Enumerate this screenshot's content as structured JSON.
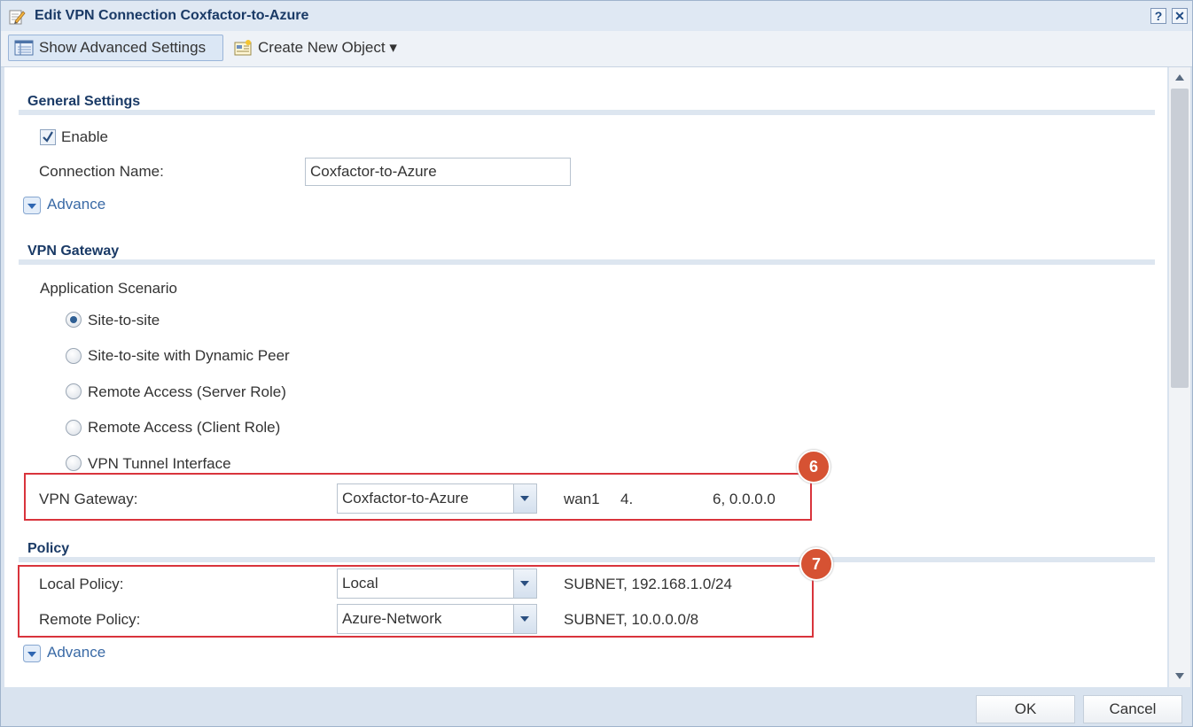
{
  "window": {
    "title": "Edit VPN Connection Coxfactor-to-Azure",
    "help_label": "?",
    "close_label": "✕"
  },
  "toolbar": {
    "advanced_label": "Show Advanced Settings",
    "create_label": "Create New Object ▾"
  },
  "general": {
    "title": "General Settings",
    "enable_label": "Enable",
    "enable_checked": true,
    "connection_name_label": "Connection Name:",
    "connection_name_value": "Coxfactor-to-Azure",
    "advance_label": "Advance"
  },
  "vpn_gateway_section": {
    "title": "VPN Gateway",
    "scenario_label": "Application Scenario",
    "options": [
      {
        "label": "Site-to-site",
        "selected": true
      },
      {
        "label": "Site-to-site with Dynamic Peer",
        "selected": false
      },
      {
        "label": "Remote Access (Server Role)",
        "selected": false
      },
      {
        "label": "Remote Access (Client Role)",
        "selected": false
      },
      {
        "label": "VPN Tunnel Interface",
        "selected": false
      }
    ],
    "gateway_label": "VPN Gateway:",
    "gateway_value": "Coxfactor-to-Azure",
    "gateway_info_iface": "wan1",
    "gateway_info_ip_prefix": "4.",
    "gateway_info_ip_suffix": "6, 0.0.0.0",
    "callout": "6"
  },
  "policy": {
    "title": "Policy",
    "local_label": "Local Policy:",
    "local_value": "Local",
    "local_info": "SUBNET, 192.168.1.0/24",
    "remote_label": "Remote Policy:",
    "remote_value": "Azure-Network",
    "remote_info": "SUBNET, 10.0.0.0/8",
    "advance_label": "Advance",
    "callout": "7"
  },
  "footer": {
    "ok_label": "OK",
    "cancel_label": "Cancel"
  },
  "colors": {
    "accent": "#1a3a66",
    "highlight": "#d9343c",
    "callout": "#d65233"
  }
}
